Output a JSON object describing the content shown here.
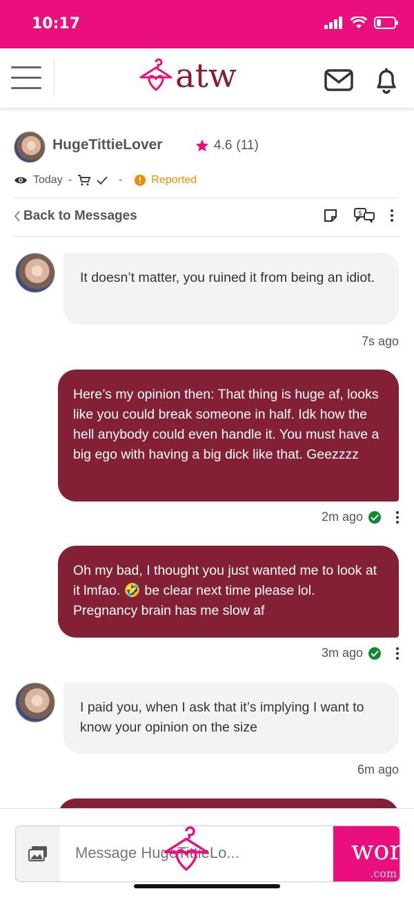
{
  "status_bar": {
    "time": "10:17"
  },
  "header": {
    "logo_text": "atw"
  },
  "profile": {
    "name": "HugeTittieLover",
    "rating": "4.6",
    "reviews": "(11)"
  },
  "meta": {
    "date": "Today",
    "sep1": "-",
    "sep2": "-",
    "reported": "Reported"
  },
  "nav": {
    "back": "Back to Messages"
  },
  "messages": [
    {
      "dir": "in",
      "text": "It doesn’t matter, you ruined it from being an idiot.",
      "time": "7s ago"
    },
    {
      "dir": "out",
      "text": "Here’s my opinion then: That thing is huge af, looks like you could break someone in half. Idk how the hell anybody could even handle it. You must have a big ego with having a big dick like that. Geezzzz",
      "time": "2m ago"
    },
    {
      "dir": "out",
      "text": "Oh my bad, I thought you just wanted me to look at it lmfao. 🤣 be clear next time please lol. Pregnancy brain has me slow af",
      "time": "3m ago"
    },
    {
      "dir": "in",
      "text": "I paid you, when I ask that it’s implying I want to know your opinion on the size",
      "time": "6m ago"
    }
  ],
  "composer": {
    "placeholder": "Message HugeTittieLo...",
    "send_big": "worn",
    "send_small": ".com"
  },
  "colors": {
    "brand_pink": "#ea0f7c",
    "outgoing_bubble": "#832036",
    "incoming_bubble": "#f3f3f3",
    "reported": "#f08a00",
    "check": "#0f8a2c"
  }
}
